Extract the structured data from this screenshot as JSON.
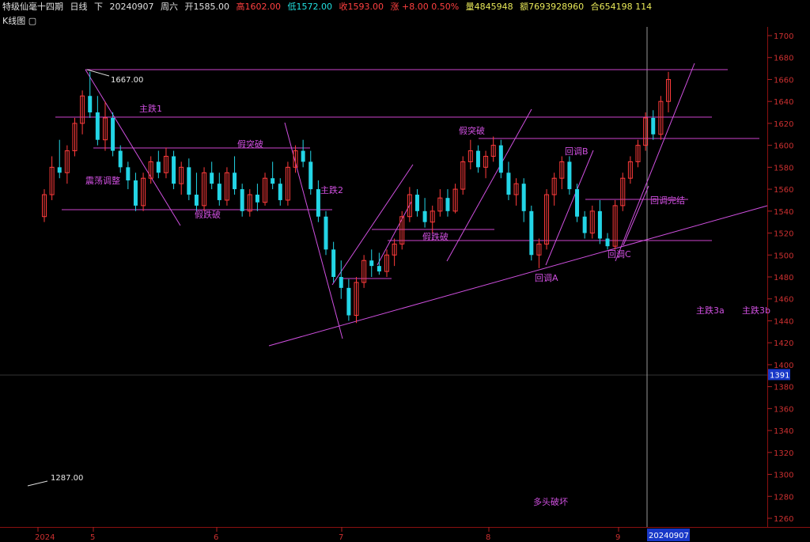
{
  "header": {
    "instrument": "特级仙毫十四期",
    "period": "日线",
    "direction": "下",
    "date": "20240907",
    "weekday": "周六",
    "open": "开1585.00",
    "high": "高1602.00",
    "low": "低1572.00",
    "close": "收1593.00",
    "change": "涨 +8.00 0.50%",
    "volume": "量4845948",
    "amount": "额7693928960",
    "position": "合654198 114"
  },
  "subheader": {
    "label": "K线图",
    "icon": "window-icon"
  },
  "colors": {
    "up": "#ff3b3b",
    "down": "#23d5e6",
    "annotation": "#d050e0",
    "axis": "#b02020",
    "hline": "#cc44cc"
  },
  "chart_data": {
    "type": "candlestick",
    "y_axis": {
      "ticks": [
        1260,
        1280,
        1300,
        1320,
        1340,
        1360,
        1380,
        1400,
        1420,
        1440,
        1460,
        1480,
        1500,
        1520,
        1540,
        1560,
        1580,
        1600,
        1620,
        1640,
        1660,
        1680,
        1700
      ],
      "range": [
        1250,
        1710
      ],
      "marker": "1391"
    },
    "x_axis": {
      "ticks": [
        "2024",
        "5",
        "6",
        "7",
        "8",
        "9"
      ],
      "cursor_label": "20240907"
    },
    "high_label": "1667.00",
    "low_label": "1287.00",
    "ohlc": [
      [
        1535,
        1560,
        1530,
        1555
      ],
      [
        1555,
        1590,
        1550,
        1580
      ],
      [
        1580,
        1605,
        1570,
        1575
      ],
      [
        1575,
        1600,
        1565,
        1595
      ],
      [
        1595,
        1625,
        1590,
        1620
      ],
      [
        1620,
        1650,
        1610,
        1645
      ],
      [
        1645,
        1667,
        1625,
        1630
      ],
      [
        1630,
        1645,
        1600,
        1605
      ],
      [
        1605,
        1640,
        1595,
        1625
      ],
      [
        1625,
        1630,
        1590,
        1595
      ],
      [
        1595,
        1600,
        1575,
        1580
      ],
      [
        1580,
        1585,
        1560,
        1568
      ],
      [
        1568,
        1575,
        1540,
        1545
      ],
      [
        1545,
        1575,
        1540,
        1570
      ],
      [
        1570,
        1590,
        1565,
        1585
      ],
      [
        1585,
        1595,
        1570,
        1575
      ],
      [
        1575,
        1598,
        1570,
        1590
      ],
      [
        1590,
        1595,
        1560,
        1565
      ],
      [
        1565,
        1585,
        1555,
        1580
      ],
      [
        1580,
        1588,
        1550,
        1555
      ],
      [
        1555,
        1575,
        1540,
        1545
      ],
      [
        1545,
        1580,
        1540,
        1575
      ],
      [
        1575,
        1585,
        1560,
        1565
      ],
      [
        1565,
        1575,
        1545,
        1550
      ],
      [
        1550,
        1580,
        1545,
        1575
      ],
      [
        1575,
        1590,
        1555,
        1560
      ],
      [
        1560,
        1565,
        1535,
        1540
      ],
      [
        1540,
        1560,
        1535,
        1555
      ],
      [
        1555,
        1565,
        1540,
        1548
      ],
      [
        1548,
        1575,
        1545,
        1570
      ],
      [
        1570,
        1585,
        1560,
        1565
      ],
      [
        1565,
        1570,
        1545,
        1550
      ],
      [
        1550,
        1585,
        1545,
        1580
      ],
      [
        1580,
        1600,
        1575,
        1595
      ],
      [
        1595,
        1605,
        1580,
        1585
      ],
      [
        1585,
        1595,
        1555,
        1560
      ],
      [
        1560,
        1568,
        1530,
        1535
      ],
      [
        1535,
        1540,
        1500,
        1505
      ],
      [
        1505,
        1512,
        1475,
        1480
      ],
      [
        1480,
        1495,
        1460,
        1470
      ],
      [
        1470,
        1478,
        1440,
        1445
      ],
      [
        1445,
        1480,
        1438,
        1475
      ],
      [
        1475,
        1500,
        1470,
        1495
      ],
      [
        1495,
        1505,
        1480,
        1490
      ],
      [
        1490,
        1502,
        1482,
        1485
      ],
      [
        1485,
        1505,
        1480,
        1500
      ],
      [
        1500,
        1515,
        1490,
        1510
      ],
      [
        1510,
        1540,
        1505,
        1535
      ],
      [
        1535,
        1562,
        1530,
        1555
      ],
      [
        1555,
        1560,
        1535,
        1540
      ],
      [
        1540,
        1552,
        1525,
        1530
      ],
      [
        1530,
        1545,
        1520,
        1540
      ],
      [
        1540,
        1560,
        1535,
        1552
      ],
      [
        1552,
        1560,
        1535,
        1540
      ],
      [
        1540,
        1565,
        1538,
        1560
      ],
      [
        1560,
        1590,
        1555,
        1585
      ],
      [
        1585,
        1605,
        1578,
        1595
      ],
      [
        1595,
        1600,
        1575,
        1580
      ],
      [
        1580,
        1595,
        1570,
        1590
      ],
      [
        1590,
        1608,
        1585,
        1600
      ],
      [
        1600,
        1605,
        1570,
        1575
      ],
      [
        1575,
        1585,
        1550,
        1555
      ],
      [
        1555,
        1570,
        1545,
        1565
      ],
      [
        1565,
        1570,
        1530,
        1540
      ],
      [
        1540,
        1545,
        1495,
        1500
      ],
      [
        1500,
        1515,
        1488,
        1510
      ],
      [
        1510,
        1560,
        1505,
        1555
      ],
      [
        1555,
        1575,
        1545,
        1570
      ],
      [
        1570,
        1590,
        1560,
        1585
      ],
      [
        1585,
        1590,
        1555,
        1560
      ],
      [
        1560,
        1565,
        1530,
        1535
      ],
      [
        1535,
        1540,
        1515,
        1520
      ],
      [
        1520,
        1545,
        1515,
        1540
      ],
      [
        1540,
        1550,
        1510,
        1515
      ],
      [
        1515,
        1520,
        1505,
        1508
      ],
      [
        1508,
        1550,
        1505,
        1545
      ],
      [
        1545,
        1575,
        1540,
        1570
      ],
      [
        1570,
        1590,
        1565,
        1585
      ],
      [
        1585,
        1605,
        1580,
        1600
      ],
      [
        1600,
        1630,
        1595,
        1625
      ],
      [
        1625,
        1632,
        1605,
        1610
      ],
      [
        1610,
        1645,
        1605,
        1640
      ],
      [
        1640,
        1667,
        1630,
        1660
      ]
    ],
    "annotations": [
      "主跌1",
      "震荡调整",
      "假跌破",
      "假突破",
      "主跌2",
      "假跌破",
      "假突破",
      "回调A",
      "回调B",
      "回调C",
      "回调完结",
      "主跌3a",
      "主跌3b",
      "多头破坏"
    ]
  }
}
